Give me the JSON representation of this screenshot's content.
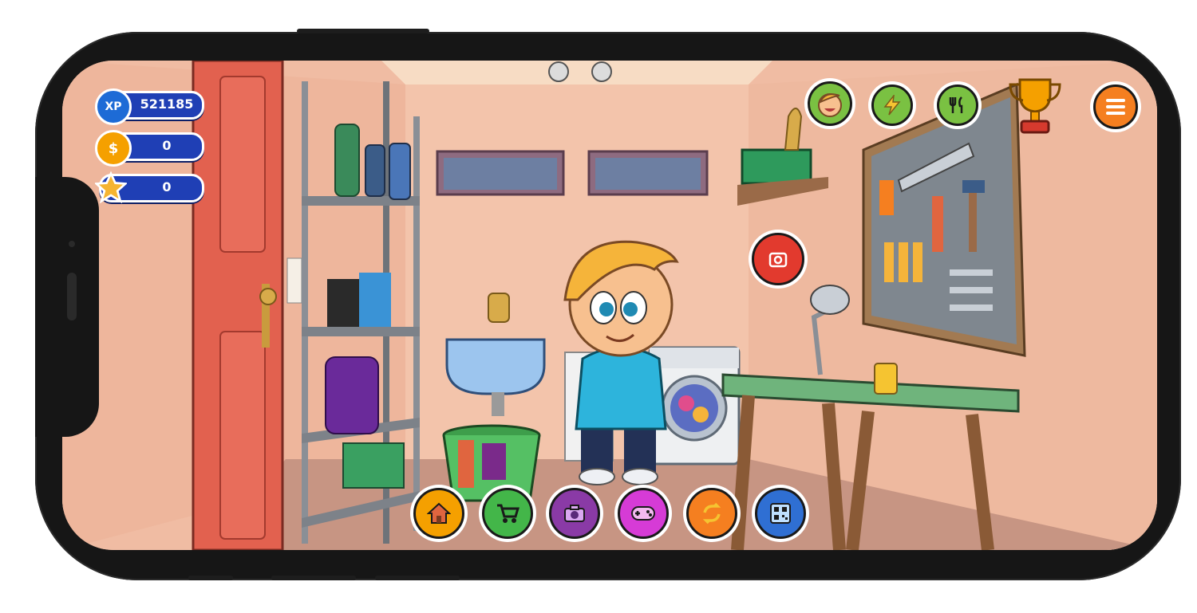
{
  "hud": {
    "xp": {
      "label": "XP",
      "value": "521185"
    },
    "coins": {
      "label": "$",
      "value": "0"
    },
    "stars": {
      "value": "0"
    }
  },
  "top_buttons": [
    {
      "name": "character-face",
      "icon": "smiling-face-icon",
      "color": "#7ac142"
    },
    {
      "name": "energy",
      "icon": "lightning-icon",
      "color": "#7ac142"
    },
    {
      "name": "food",
      "icon": "fork-knife-icon",
      "color": "#7ac142"
    },
    {
      "name": "trophy",
      "icon": "trophy-icon",
      "color": "#f5a000"
    },
    {
      "name": "menu",
      "icon": "hamburger-menu-icon",
      "color": "#f57f20"
    }
  ],
  "bottom_buttons": [
    {
      "name": "home",
      "icon": "house-icon",
      "color": "#f5a000"
    },
    {
      "name": "shop",
      "icon": "cart-icon",
      "color": "#43b649"
    },
    {
      "name": "photo",
      "icon": "camera-icon",
      "color": "#8a3aa6"
    },
    {
      "name": "games",
      "icon": "gamepad-icon",
      "color": "#d63bd6"
    },
    {
      "name": "swap",
      "icon": "refresh-icon",
      "color": "#f57f20"
    },
    {
      "name": "qr",
      "icon": "qr-code-icon",
      "color": "#2f6fd3"
    }
  ],
  "scene": {
    "room": "laundry-room",
    "hint_bubble_icon": "camera-outline-icon",
    "wall_color": "#f1bea5",
    "floor_color": "#c49383",
    "door_color": "#e2614f"
  }
}
